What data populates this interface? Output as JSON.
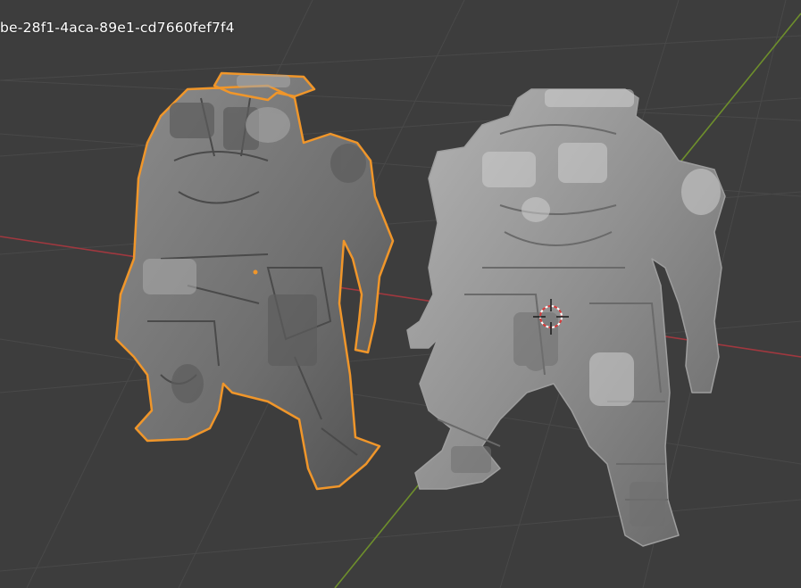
{
  "viewport": {
    "object_name_overlay": "be-28f1-4aca-89e1-cd7660fef7f4",
    "background_color": "#3d3d3d",
    "grid_color": "#494949",
    "x_axis_color": "#a0383f",
    "y_axis_color": "#6e8f2c",
    "selection_outline_color": "#f0962a",
    "mesh_color": "#8a8a8a"
  },
  "scene": {
    "objects": [
      {
        "label": "robot-mech-selected",
        "selected": true,
        "shading": "solid"
      },
      {
        "label": "robot-mech-smooth",
        "selected": false,
        "shading": "solid"
      }
    ],
    "widgets": [
      "3d-cursor-icon"
    ]
  }
}
